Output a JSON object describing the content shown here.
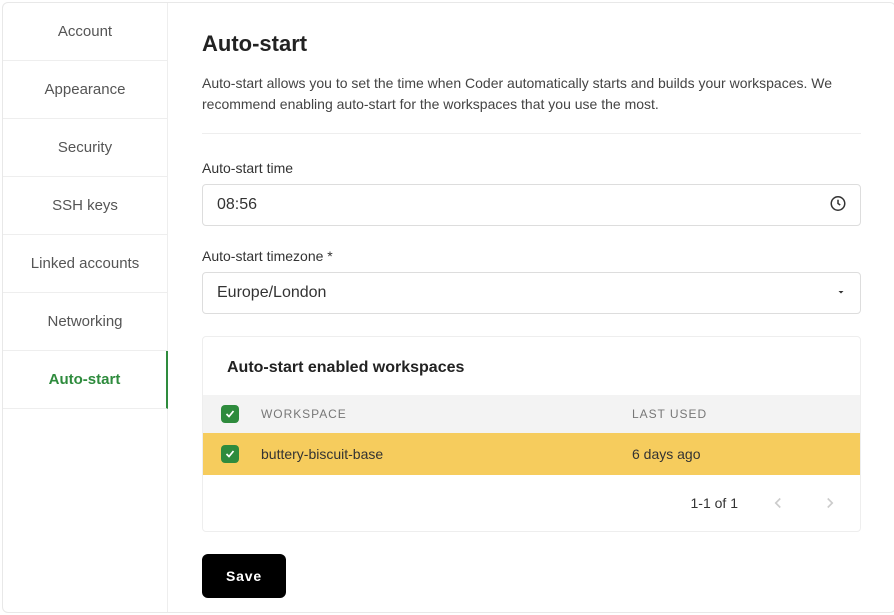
{
  "sidebar": {
    "items": [
      {
        "label": "Account"
      },
      {
        "label": "Appearance"
      },
      {
        "label": "Security"
      },
      {
        "label": "SSH keys"
      },
      {
        "label": "Linked accounts"
      },
      {
        "label": "Networking"
      },
      {
        "label": "Auto-start"
      }
    ],
    "active_index": 6
  },
  "page": {
    "title": "Auto-start",
    "description": "Auto-start allows you to set the time when Coder automatically starts and builds your workspaces. We recommend enabling auto-start for the workspaces that you use the most."
  },
  "form": {
    "time_label": "Auto-start time",
    "time_value": "08:56",
    "tz_label": "Auto-start timezone",
    "tz_required_mark": "*",
    "tz_value": "Europe/London"
  },
  "table": {
    "title": "Auto-start enabled workspaces",
    "columns": {
      "workspace": "WORKSPACE",
      "last_used": "LAST USED"
    },
    "rows": [
      {
        "checked": true,
        "workspace": "buttery-biscuit-base",
        "last_used": "6 days ago"
      }
    ],
    "header_checked": true,
    "pagination": "1-1 of 1"
  },
  "actions": {
    "save_label": "Save"
  }
}
